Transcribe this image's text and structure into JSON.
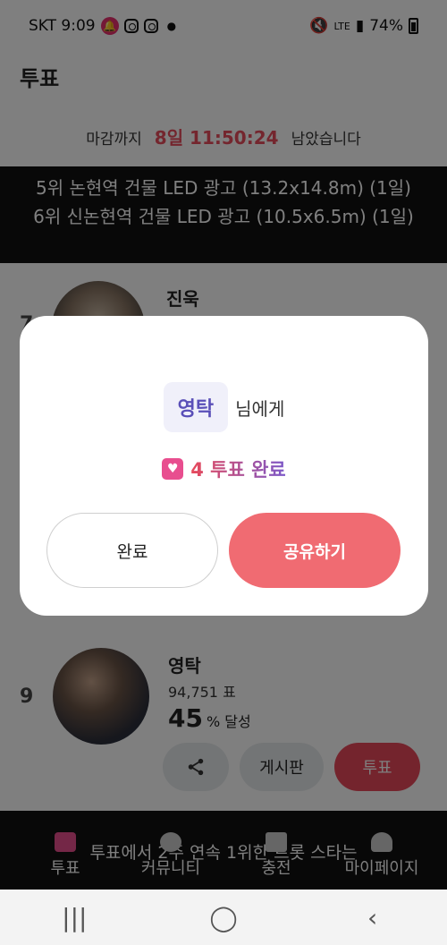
{
  "status_bar": {
    "carrier_time": "SKT 9:09",
    "network": "LTE",
    "battery": "74%"
  },
  "header": {
    "title": "투표"
  },
  "deadline": {
    "prefix": "마감까지",
    "countdown": "8일 11:50:24",
    "suffix": "남았습니다"
  },
  "banner": {
    "lines": [
      "5위 논현역 건물 LED 광고 (13.2x14.8m) (1일)",
      "6위 신논현역 건물 LED 광고 (10.5x6.5m) (1일)"
    ]
  },
  "candidates": [
    {
      "rank": "7",
      "name": "진욱"
    },
    {
      "rank": "9",
      "name": "영탁",
      "votes": "94,751 표",
      "percent": "45",
      "percent_suffix": "% 달성"
    }
  ],
  "card_actions": {
    "board": "게시판",
    "vote": "투표"
  },
  "notice": {
    "text": "투표에서 2주 연속 1위한 트롯 스타는"
  },
  "bottom_nav": [
    {
      "label": "투표",
      "icon": "heart-icon"
    },
    {
      "label": "커뮤니티",
      "icon": "chat-icon"
    },
    {
      "label": "충전",
      "icon": "shirt-icon"
    },
    {
      "label": "마이페이지",
      "icon": "person-icon"
    }
  ],
  "modal": {
    "recipient": "영탁",
    "recipient_suffix": "님에게",
    "vote_done": "4 투표 완료",
    "done_button": "완료",
    "share_button": "공유하기"
  },
  "colors": {
    "accent_red": "#e94c5c",
    "share_button": "#f06b72",
    "recipient_purple": "#5a4fb8"
  }
}
